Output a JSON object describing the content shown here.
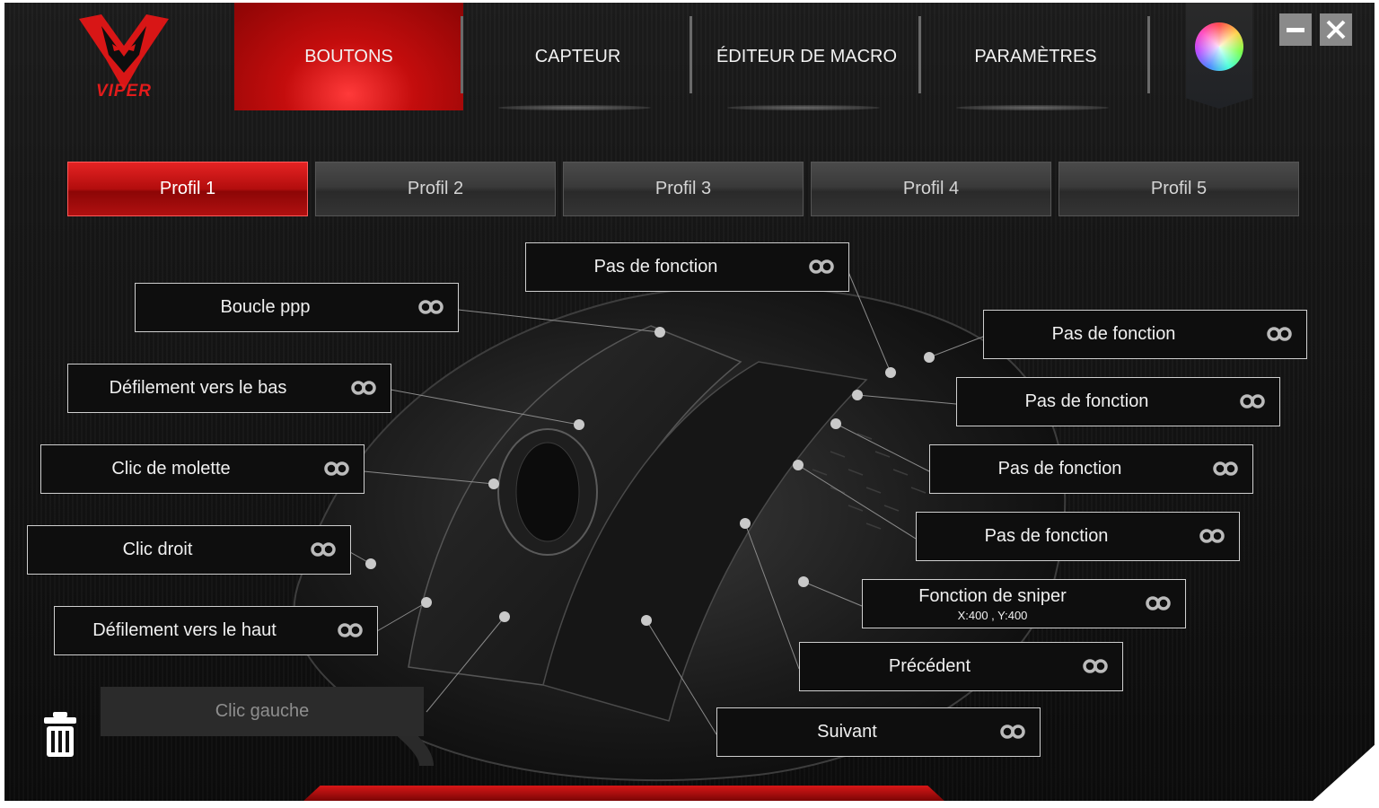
{
  "app": {
    "logo_text": "VIPER",
    "tabs": [
      {
        "label": "BOUTONS",
        "active": true
      },
      {
        "label": "CAPTEUR",
        "active": false
      },
      {
        "label": "ÉDITEUR DE MACRO",
        "active": false
      },
      {
        "label": "PARAMÈTRES",
        "active": false
      }
    ],
    "window_controls": {
      "minimize_icon": "minimize-icon",
      "close_icon": "close-icon"
    },
    "accent_color": "#d81616"
  },
  "profiles": [
    {
      "label": "Profil 1",
      "active": true
    },
    {
      "label": "Profil 2",
      "active": false
    },
    {
      "label": "Profil 3",
      "active": false
    },
    {
      "label": "Profil 4",
      "active": false
    },
    {
      "label": "Profil 5",
      "active": false
    }
  ],
  "buttons": {
    "top": "Pas de fonction",
    "dpi_loop": "Boucle ppp",
    "scroll_down": "Défilement vers le bas",
    "wheel_click": "Clic de molette",
    "right_click": "Clic droit",
    "scroll_up": "Défilement vers le haut",
    "left_click": "Clic gauche",
    "side_1": "Pas de fonction",
    "side_2": "Pas de fonction",
    "side_3": "Pas de fonction",
    "side_4": "Pas de fonction",
    "sniper": "Fonction de sniper",
    "sniper_values": "X:400 , Y:400",
    "back": "Précédent",
    "forward": "Suivant"
  },
  "icons": {
    "link": "link-icon",
    "trash": "trash-icon",
    "color": "color-wheel-icon"
  }
}
